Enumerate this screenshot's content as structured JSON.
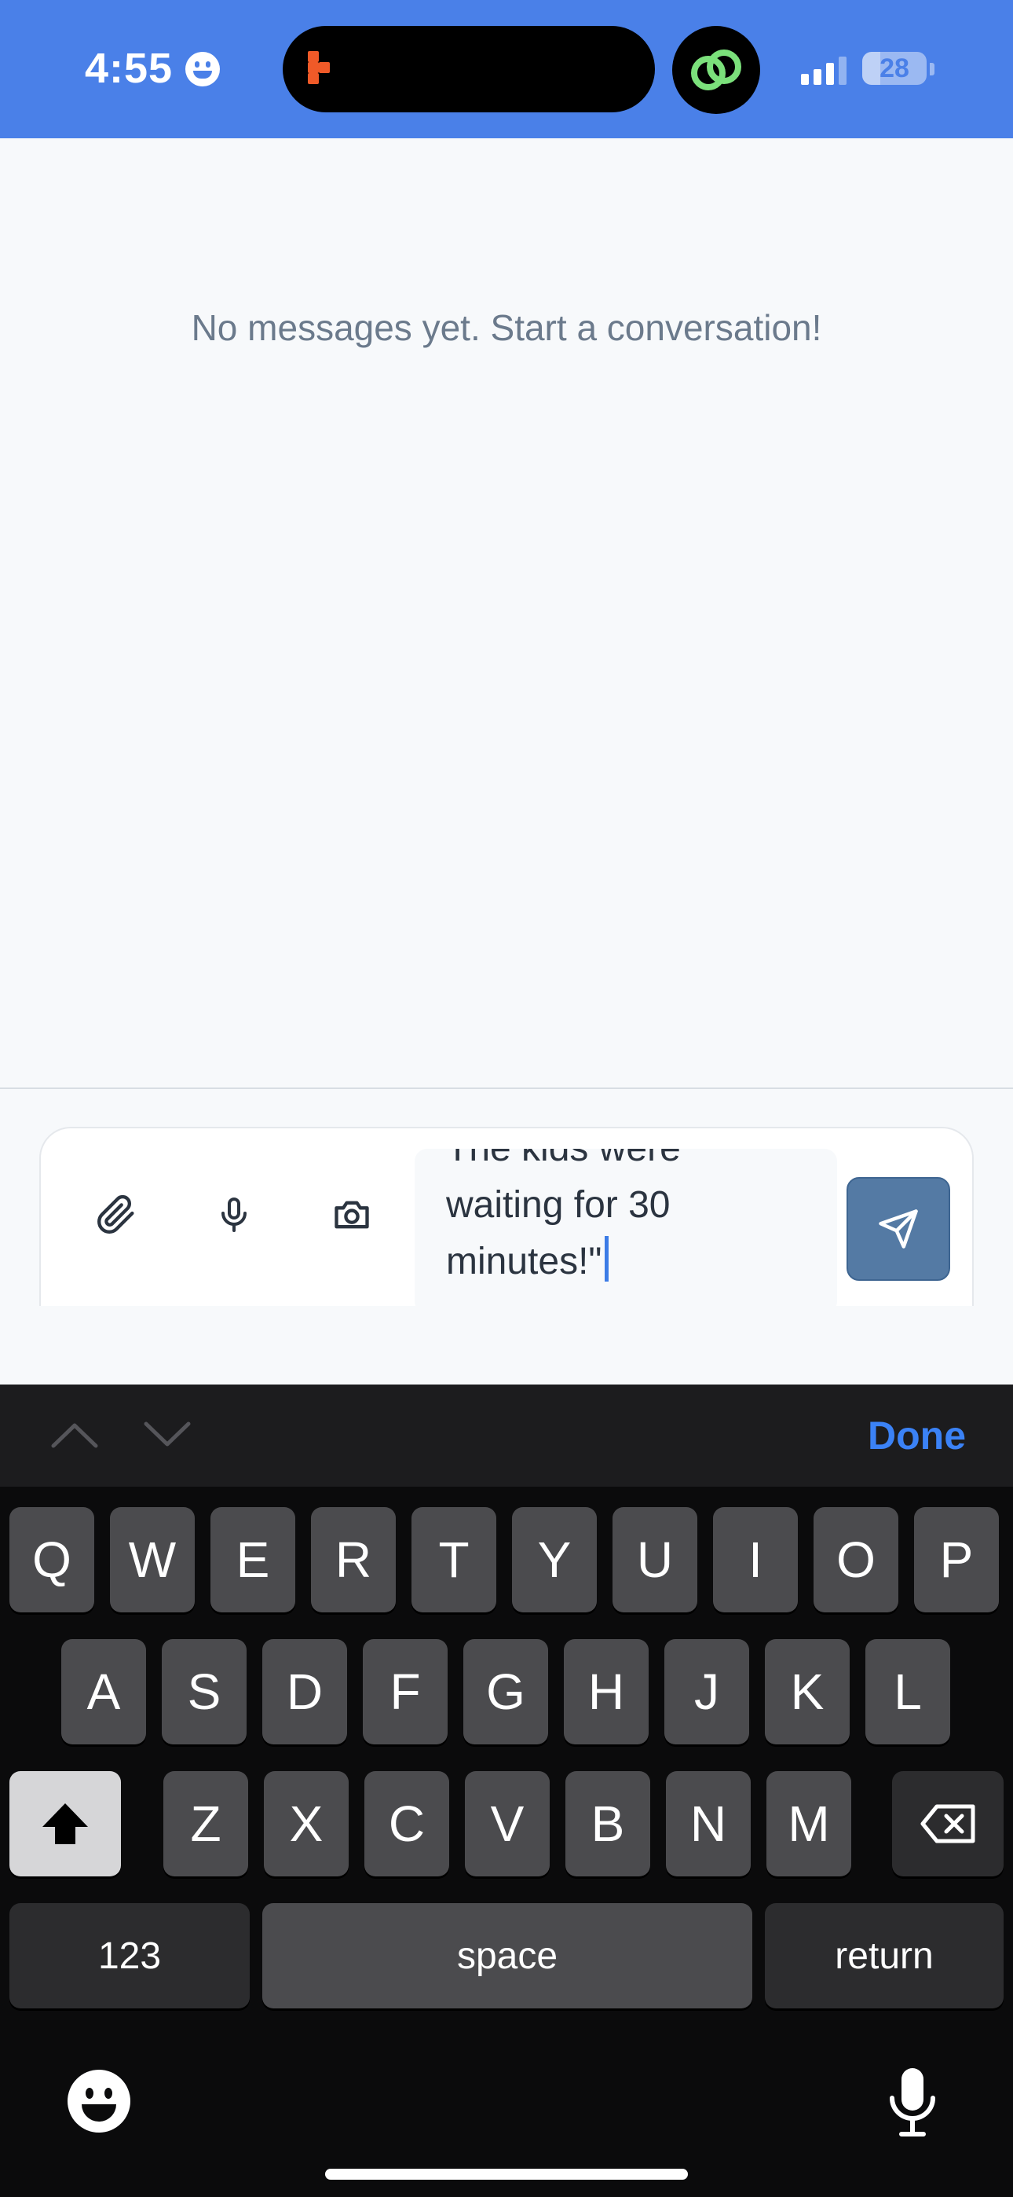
{
  "status_bar": {
    "time": "4:55",
    "battery": "28",
    "battery_level": 0.28,
    "accent_color": "#4a80e8"
  },
  "chat": {
    "empty_state": "No messages yet. Start a conversation!"
  },
  "composer": {
    "tools": [
      "paperclip-icon",
      "microphone-icon",
      "camera-icon"
    ],
    "text_lines": [
      "The kids were",
      "waiting for 30",
      "minutes!\""
    ],
    "send_color": "#547aa4"
  },
  "keyboard": {
    "done_label": "Done",
    "row1": [
      "Q",
      "W",
      "E",
      "R",
      "T",
      "Y",
      "U",
      "I",
      "O",
      "P"
    ],
    "row2": [
      "A",
      "S",
      "D",
      "F",
      "G",
      "H",
      "J",
      "K",
      "L"
    ],
    "row3": [
      "Z",
      "X",
      "C",
      "V",
      "B",
      "N",
      "M"
    ],
    "numbers_label": "123",
    "space_label": "space",
    "return_label": "return",
    "accent_color": "#3b82f6"
  }
}
